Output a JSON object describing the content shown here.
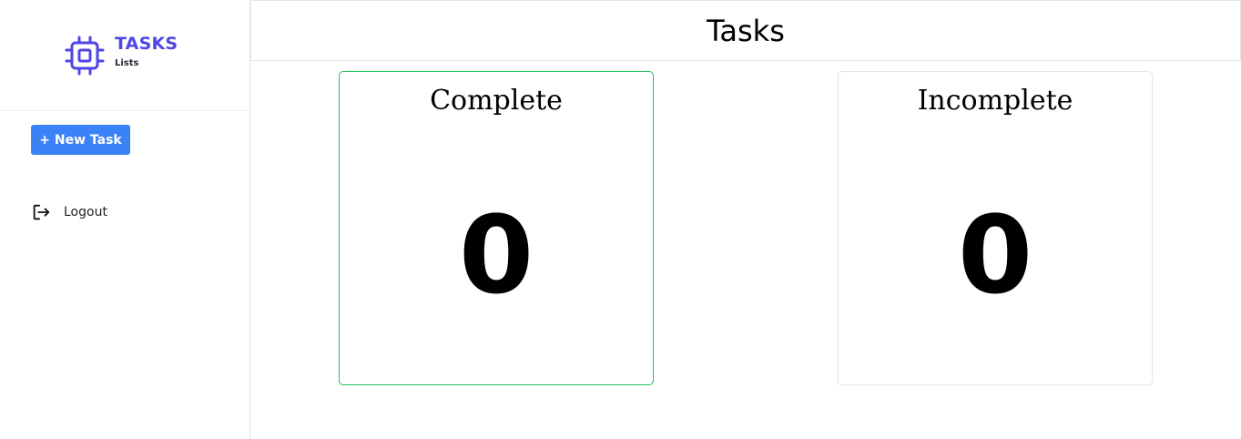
{
  "sidebar": {
    "brand": {
      "title": "TASKS",
      "subtitle": "Lists",
      "icon": "cpu-chip-icon",
      "color": "#4f46e5"
    },
    "new_task_label": "+ New Task",
    "new_task_color": "#3b82f6",
    "logout": {
      "label": "Logout",
      "icon": "logout-icon"
    }
  },
  "header": {
    "title": "Tasks"
  },
  "cards": [
    {
      "title": "Complete",
      "count": "0",
      "border_color": "#22c55e"
    },
    {
      "title": "Incomplete",
      "count": "0",
      "border_color": "#e5e7eb"
    }
  ]
}
